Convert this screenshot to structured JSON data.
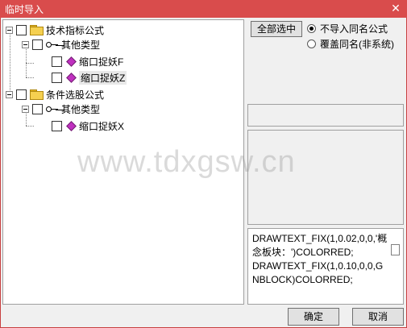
{
  "window": {
    "title": "临时导入",
    "close_glyph": "✕"
  },
  "tree": {
    "groups": [
      {
        "label": "技术指标公式",
        "subgroup": "其他类型",
        "items": [
          "缩口捉妖F",
          "缩口捉妖Z"
        ]
      },
      {
        "label": "条件选股公式",
        "subgroup": "其他类型",
        "items": [
          "缩口捉妖X"
        ]
      }
    ]
  },
  "options": {
    "select_all_label": "全部选中",
    "radio_no_import": "不导入同名公式",
    "radio_overwrite": "覆盖同名(非系统)",
    "selected": "no_import"
  },
  "code_text": "DRAWTEXT_FIX(1,0.02,0,0,'概念板块：')COLORRED;\nDRAWTEXT_FIX(1,0.10,0,0,GNBLOCK)COLORRED;",
  "watermark": "www.tdxgsw.cn",
  "buttons": {
    "ok": "确定",
    "cancel": "取消"
  },
  "icons": [
    "folder-icon",
    "key-icon",
    "diamond-icon",
    "close-icon",
    "expander-icon",
    "checkbox-icon"
  ]
}
